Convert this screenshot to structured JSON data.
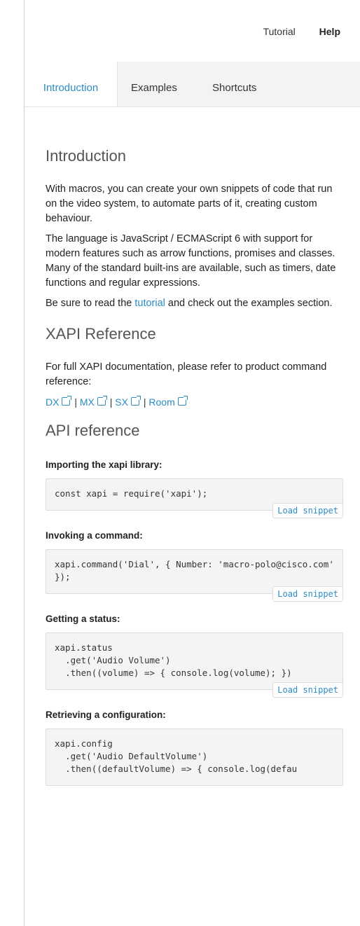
{
  "header": {
    "tutorial": "Tutorial",
    "help": "Help"
  },
  "tabs": [
    "Introduction",
    "Examples",
    "Shortcuts"
  ],
  "intro": {
    "title": "Introduction",
    "p1": "With macros, you can create your own snippets of code that run on the video system, to automate parts of it, creating custom behaviour.",
    "p2": "The language is JavaScript / ECMAScript 6 with support for modern features such as arrow functions, promises and classes. Many of the standard built-ins are available, such as timers, date functions and regular expressions.",
    "p3_pre": "Be sure to read the ",
    "p3_link": "tutorial",
    "p3_post": " and check out the examples section."
  },
  "xapi": {
    "title": "XAPI Reference",
    "text": "For full XAPI documentation, please refer to product command reference:",
    "links": [
      "DX",
      "MX",
      "SX",
      "Room"
    ],
    "separator": "|"
  },
  "api": {
    "title": "API reference",
    "load_label": "Load snippet",
    "snippets": [
      {
        "label": "Importing the xapi library:",
        "code": "const xapi = require('xapi');"
      },
      {
        "label": "Invoking a command:",
        "code": "xapi.command('Dial', { Number: 'macro-polo@cisco.com' });"
      },
      {
        "label": "Getting a status:",
        "code": "xapi.status\n  .get('Audio Volume')\n  .then((volume) => { console.log(volume); })"
      },
      {
        "label": "Retrieving a configuration:",
        "code": "xapi.config\n  .get('Audio DefaultVolume')\n  .then((defaultVolume) => { console.log(defau"
      }
    ]
  },
  "colors": {
    "accent": "#2a8dc4",
    "tab_bg": "#f3f3f3",
    "snippet_bg": "#f4f4f4"
  }
}
